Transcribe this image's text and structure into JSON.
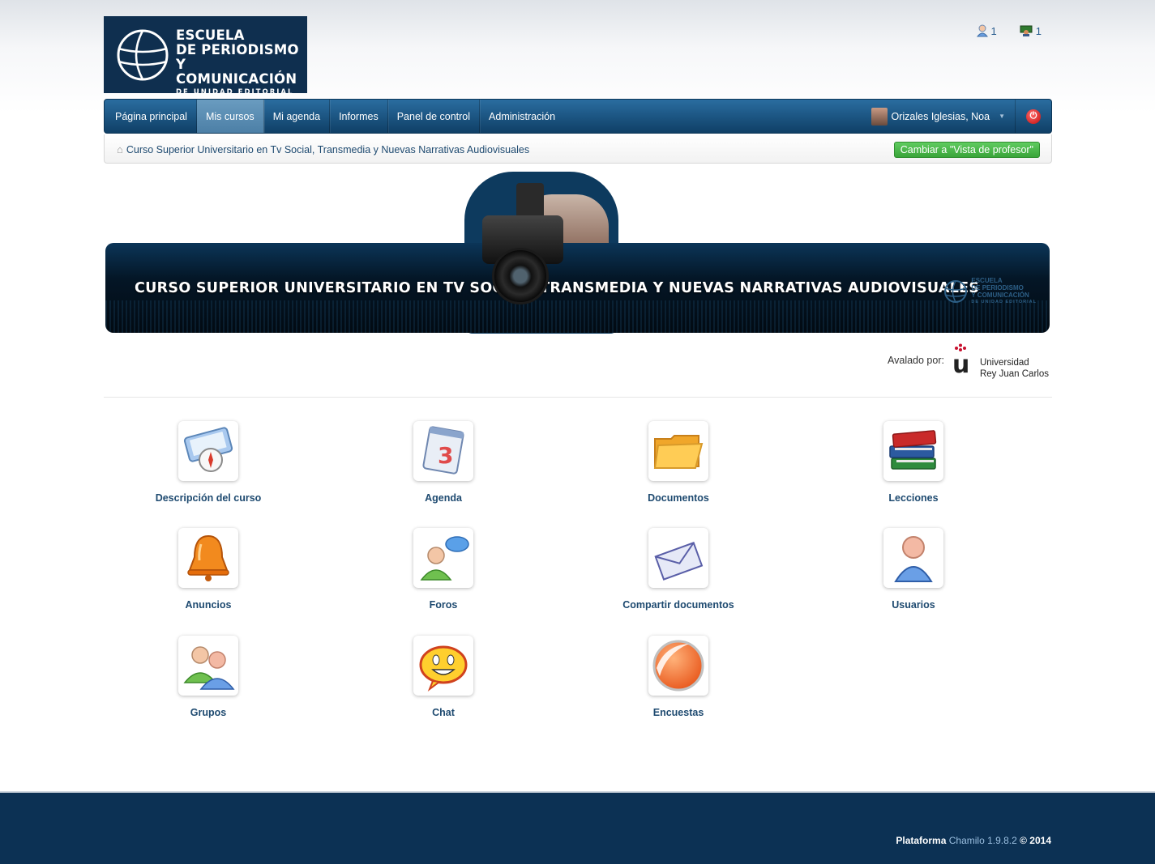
{
  "header": {
    "logo_lines": [
      "ESCUELA",
      "DE PERIODISMO",
      "Y COMUNICACIÓN"
    ],
    "logo_subline": "DE UNIDAD EDITORIAL",
    "top_icons": [
      {
        "icon": "user-icon",
        "count": "1"
      },
      {
        "icon": "teacher-icon",
        "count": "1"
      }
    ]
  },
  "navbar": {
    "items": [
      {
        "label": "Página principal",
        "active": false
      },
      {
        "label": "Mis cursos",
        "active": true
      },
      {
        "label": "Mi agenda",
        "active": false
      },
      {
        "label": "Informes",
        "active": false
      },
      {
        "label": "Panel de control",
        "active": false
      },
      {
        "label": "Administración",
        "active": false
      }
    ],
    "user_name": "Orizales Iglesias, Noa"
  },
  "breadcrumb": {
    "course": "Curso Superior Universitario en Tv Social, Transmedia y Nuevas Narrativas Audiovisuales",
    "switch_button": "Cambiar a \"Vista de profesor\""
  },
  "banner": {
    "title": "CURSO SUPERIOR UNIVERSITARIO EN TV SOCIAL, TRANSMEDIA Y NUEVAS NARRATIVAS AUDIOVISUALES",
    "mini_logo": [
      "ESCUELA",
      "DE PERIODISMO",
      "Y COMUNICACIÓN",
      "DE UNIDAD EDITORIAL"
    ]
  },
  "endorsement": {
    "label": "Avalado por:",
    "university_line1": "Universidad",
    "university_line2": "Rey Juan Carlos"
  },
  "tools": [
    {
      "label": "Descripción del curso",
      "icon": "compass-icon"
    },
    {
      "label": "Agenda",
      "icon": "calendar-icon"
    },
    {
      "label": "Documentos",
      "icon": "folder-icon"
    },
    {
      "label": "Lecciones",
      "icon": "books-icon"
    },
    {
      "label": "Anuncios",
      "icon": "bell-icon"
    },
    {
      "label": "Foros",
      "icon": "forum-icon"
    },
    {
      "label": "Compartir documentos",
      "icon": "envelope-icon"
    },
    {
      "label": "Usuarios",
      "icon": "user-icon"
    },
    {
      "label": "Grupos",
      "icon": "group-icon"
    },
    {
      "label": "Chat",
      "icon": "chat-icon"
    },
    {
      "label": "Encuestas",
      "icon": "survey-icon"
    }
  ],
  "footer": {
    "prefix": "Plataforma",
    "product": "Chamilo 1.9.8.2",
    "suffix": "© 2014"
  },
  "colors": {
    "navbar": "#1d5a88",
    "footer": "#0c3154",
    "switch_button": "#47b347",
    "link": "#1e4a70"
  }
}
